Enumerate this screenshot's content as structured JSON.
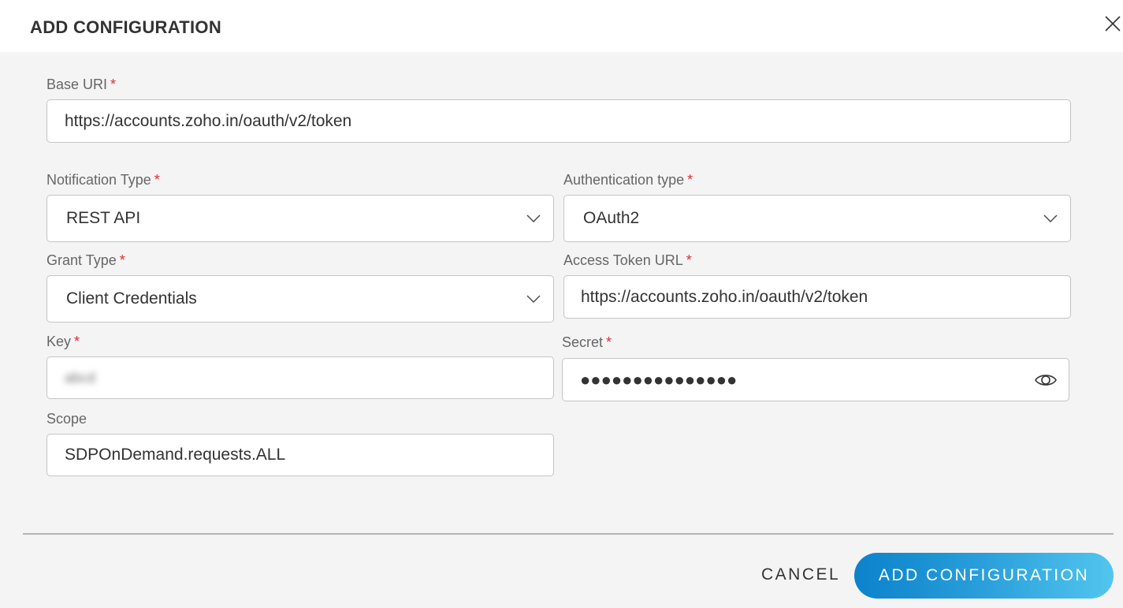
{
  "dialog": {
    "title": "ADD CONFIGURATION",
    "close_icon": "close-icon"
  },
  "form": {
    "required_mark": "*",
    "base_uri": {
      "label": "Base URI",
      "value": "https://accounts.zoho.in/oauth/v2/token"
    },
    "notification_type": {
      "label": "Notification Type",
      "value": "REST API"
    },
    "authentication_type": {
      "label": "Authentication type",
      "value": "OAuth2"
    },
    "grant_type": {
      "label": "Grant Type",
      "value": "Client Credentials"
    },
    "access_token_url": {
      "label": "Access Token URL",
      "value": "https://accounts.zoho.in/oauth/v2/token"
    },
    "key": {
      "label": "Key",
      "value": "abcd"
    },
    "secret": {
      "label": "Secret",
      "value": "●●●●●●●●●●●●●●●",
      "toggle_icon": "eye-icon"
    },
    "scope": {
      "label": "Scope",
      "value": "SDPOnDemand.requests.ALL"
    }
  },
  "footer": {
    "cancel_label": "CANCEL",
    "submit_label": "ADD CONFIGURATION"
  },
  "colors": {
    "accent_start": "#0b82cb",
    "accent_end": "#52c6ee",
    "required": "#e02b2b"
  }
}
